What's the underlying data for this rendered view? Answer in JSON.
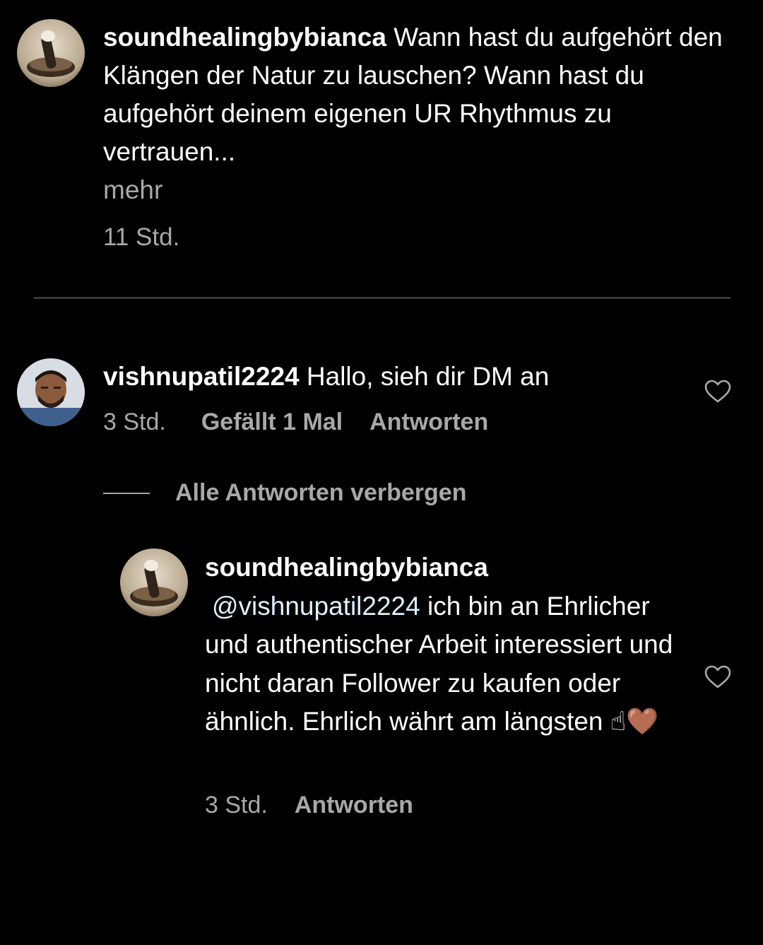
{
  "caption": {
    "username": "soundhealingbybianca",
    "text": "Wann hast du aufgehört den Klängen der Natur zu lauschen? Wann hast du aufgehört deinem eigenen UR Rhythmus zu vertrauen...",
    "more_label": "mehr",
    "time": "11 Std."
  },
  "comment": {
    "username": "vishnupatil2224",
    "text": "Hallo, sieh dir DM an",
    "time": "3 Std.",
    "likes_label": "Gefällt 1 Mal",
    "reply_label": "Antworten",
    "like_icon": "heart-outline-icon"
  },
  "replies_toggle": {
    "label": "Alle Antworten verbergen"
  },
  "reply": {
    "username": "soundhealingbybianca",
    "mention": "@vishnupatil2224",
    "text": "ich bin an Ehrlicher und authentischer Arbeit interessiert und nicht daran Follower zu kaufen oder ähnlich. Ehrlich währt am längsten",
    "emoji": "☝🤎",
    "time": "3 Std.",
    "reply_label": "Antworten",
    "like_icon": "heart-outline-icon"
  },
  "colors": {
    "background": "#000000",
    "text_primary": "#ffffff",
    "text_secondary": "#a8a8a8",
    "mention": "#e0f1ff",
    "divider": "#3a3a3a"
  }
}
